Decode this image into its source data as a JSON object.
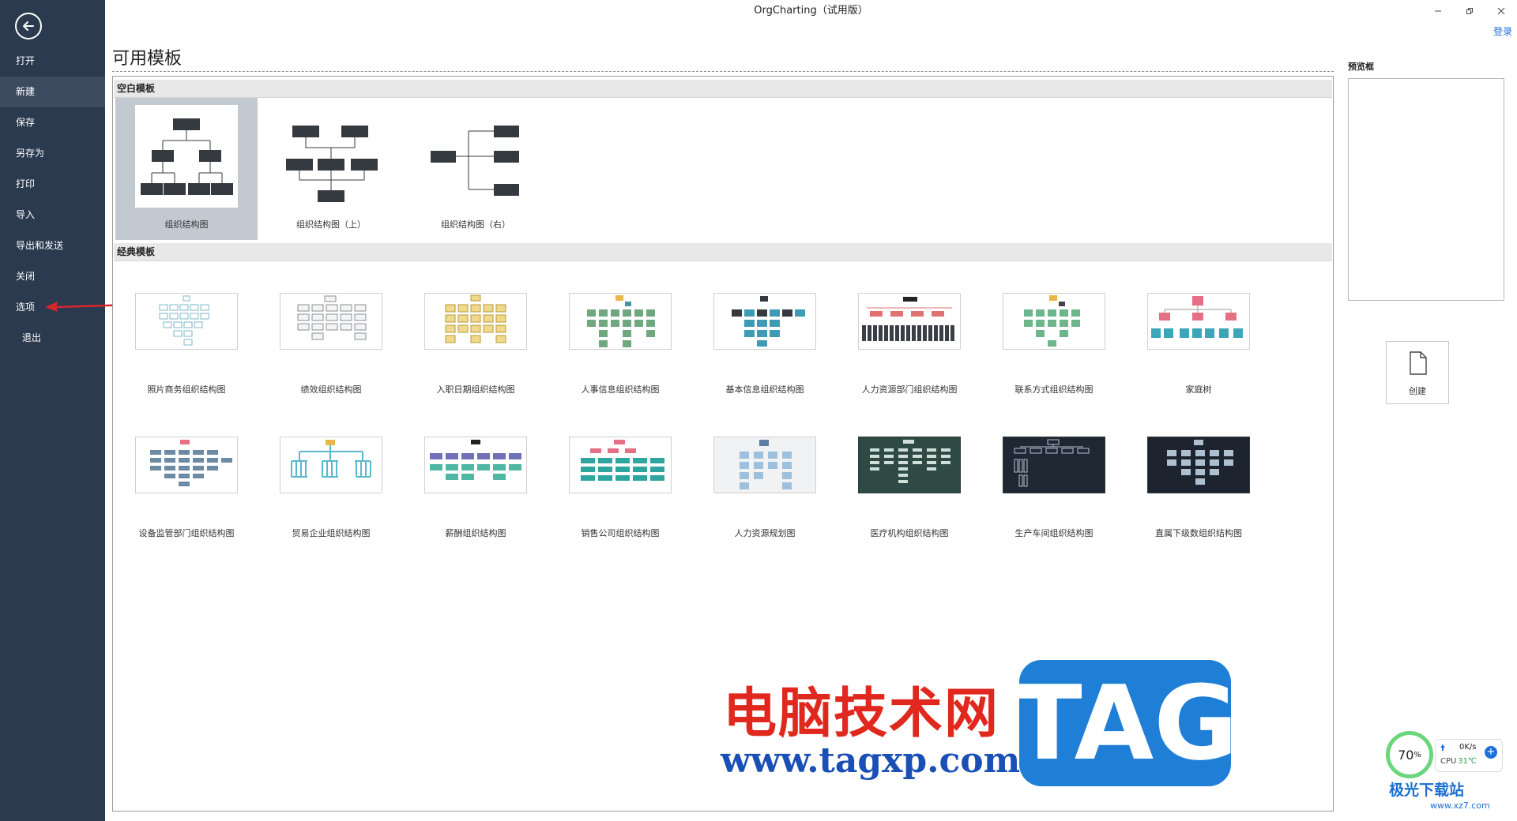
{
  "app": {
    "title": "OrgCharting（试用版）",
    "login": "登录"
  },
  "sidebar": {
    "items": [
      {
        "label": "打开"
      },
      {
        "label": "新建"
      },
      {
        "label": "保存"
      },
      {
        "label": "另存为"
      },
      {
        "label": "打印"
      },
      {
        "label": "导入"
      },
      {
        "label": "导出和发送"
      },
      {
        "label": "关闭"
      },
      {
        "label": "选项"
      },
      {
        "label": "退出"
      }
    ]
  },
  "main": {
    "title": "可用模板",
    "blank_section": {
      "header": "空白模板",
      "templates": [
        {
          "label": "组织结构图"
        },
        {
          "label": "组织结构图（上）"
        },
        {
          "label": "组织结构图（右）"
        }
      ]
    },
    "classic_section": {
      "header": "经典模板",
      "templates": [
        {
          "label": "照片商务组织结构图"
        },
        {
          "label": "绩效组织结构图"
        },
        {
          "label": "入职日期组织结构图"
        },
        {
          "label": "人事信息组织结构图"
        },
        {
          "label": "基本信息组织结构图"
        },
        {
          "label": "人力资源部门组织结构图"
        },
        {
          "label": "联系方式组织结构图"
        },
        {
          "label": "家庭树"
        },
        {
          "label": "设备监管部门组织结构图"
        },
        {
          "label": "贸易企业组织结构图"
        },
        {
          "label": "薪酬组织结构图"
        },
        {
          "label": "销售公司组织结构图"
        },
        {
          "label": "人力资源规划图"
        },
        {
          "label": "医疗机构组织结构图"
        },
        {
          "label": "生产车间组织结构图"
        },
        {
          "label": "直属下级数组织结构图"
        }
      ]
    }
  },
  "preview": {
    "label": "预览框"
  },
  "create": {
    "label": "创建"
  },
  "watermark": {
    "cn_text": "电脑技术网",
    "url": "www.tagxp.com",
    "tag": "TAG",
    "site_logo": "极光下载站",
    "site_url": "www.xz7.com"
  },
  "widget": {
    "percent": "70",
    "unit": "%",
    "speed": "0K/s",
    "cpu_label": "CPU",
    "cpu_temp": "31℃"
  },
  "colors": {
    "sidebar_bg": "#2b3a4f",
    "selected_bg": "#c3c9d1",
    "node_dark": "#353a40",
    "accent_blue": "#1e6fd9"
  }
}
